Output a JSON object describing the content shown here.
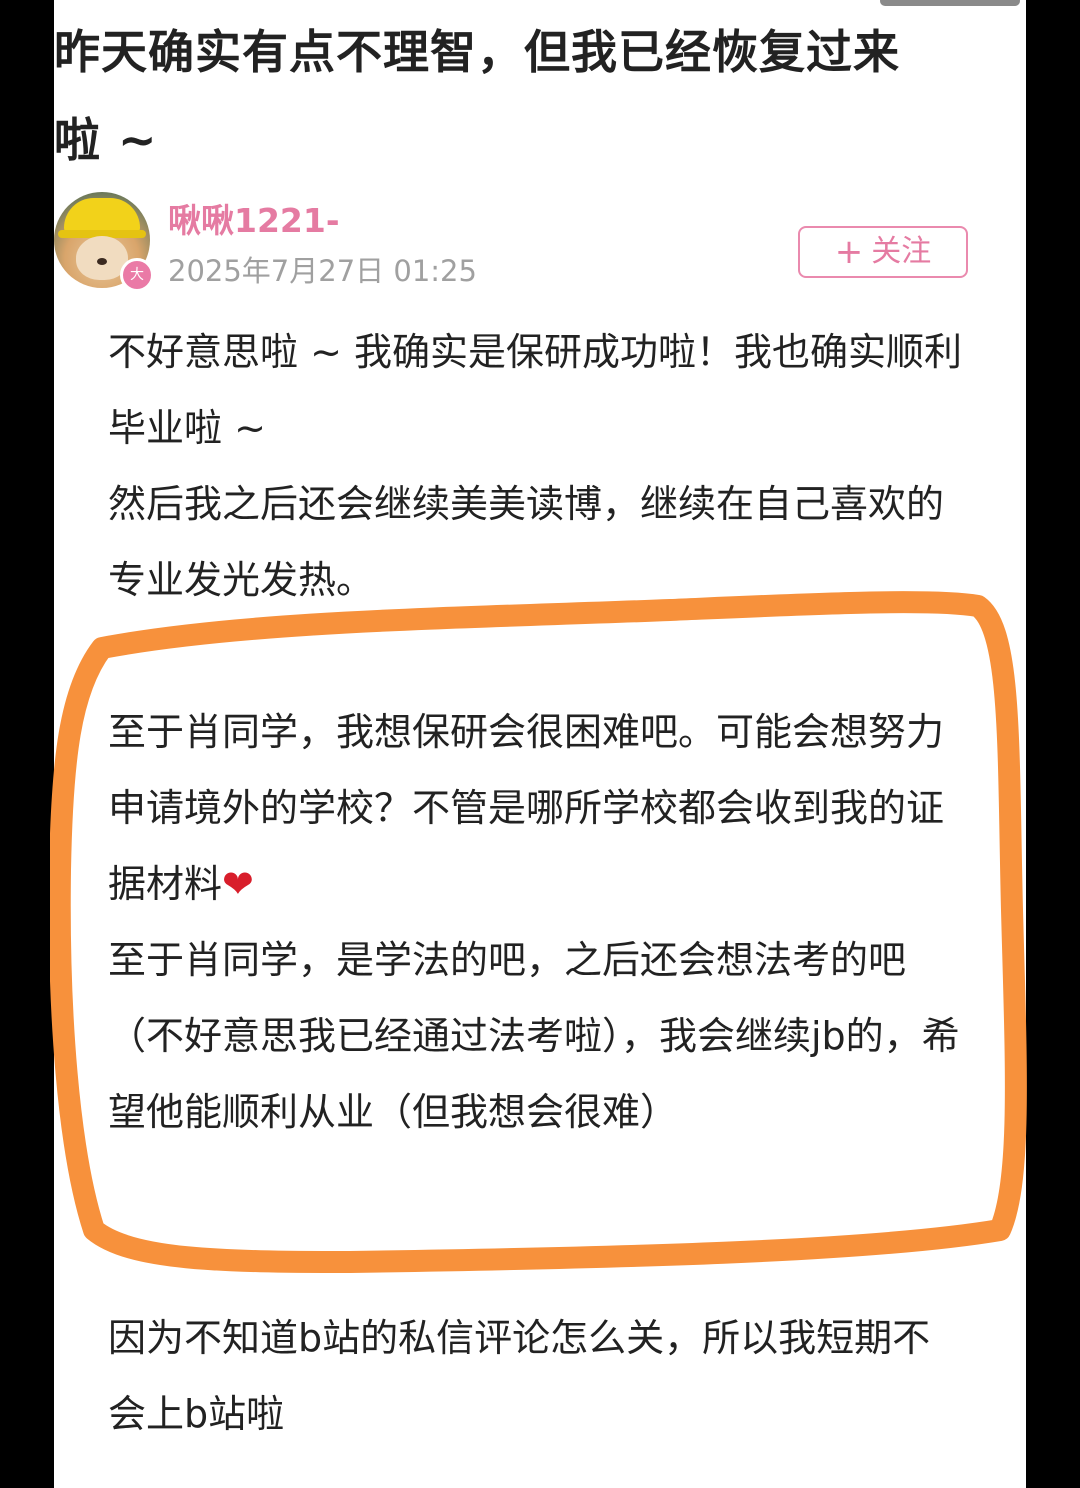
{
  "post": {
    "title": "昨天确实有点不理智，但我已经恢复过来啦 ~",
    "author": {
      "name": "啾啾1221-",
      "timestamp": "2025年7月27日 01:25",
      "badge": "大",
      "avatar_icon": "shiba-dog-hardhat-avatar"
    },
    "follow_button": {
      "plus": "+",
      "label": "关注"
    },
    "body": {
      "para1_line1": "不好意思啦 ~ 我确实是保研成功啦！我也确实顺利毕业啦 ~",
      "para1_line2": "然后我之后还会继续美美读博，继续在自己喜欢的专业发光发热。",
      "para2_line1": "至于肖同学，我想保研会很困难吧。可能会想努力申请境外的学校？不管是哪所学校都会收到我的证据材料",
      "heart": "❤",
      "para2_line2": "至于肖同学，是学法的吧，之后还会想法考的吧（不好意思我已经通过法考啦），我会继续jb的，希望他能顺利从业（但我想会很难）",
      "para3": "因为不知道b站的私信评论怎么关，所以我短期不会上b站啦"
    }
  },
  "colors": {
    "accent_pink": "#e57ba2",
    "highlight_orange": "#f7913c",
    "text": "#222222",
    "muted": "#a0a0a0"
  }
}
